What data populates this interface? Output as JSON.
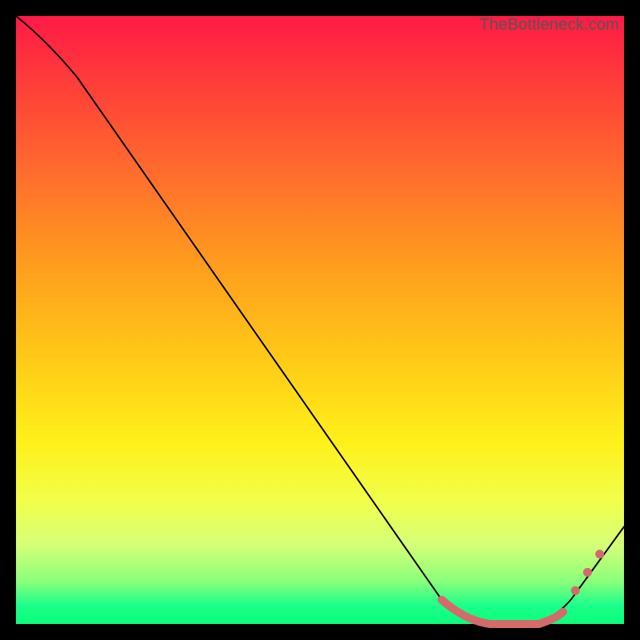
{
  "watermark": "TheBottleneck.com",
  "chart_data": {
    "type": "line",
    "title": "",
    "xlabel": "",
    "ylabel": "",
    "xlim": [
      0,
      100
    ],
    "ylim": [
      0,
      100
    ],
    "grid": false,
    "series": [
      {
        "name": "curve",
        "points": [
          {
            "x": 0,
            "y": 100
          },
          {
            "x": 6,
            "y": 94
          },
          {
            "x": 10,
            "y": 90
          },
          {
            "x": 70,
            "y": 4
          },
          {
            "x": 74,
            "y": 1
          },
          {
            "x": 78,
            "y": 0
          },
          {
            "x": 86,
            "y": 0
          },
          {
            "x": 90,
            "y": 2
          },
          {
            "x": 100,
            "y": 16
          }
        ]
      }
    ],
    "marker_band": {
      "start_x": 70,
      "end_x": 90,
      "dots_x": [
        92,
        94,
        96
      ]
    },
    "colors": {
      "line": "#000000",
      "marker": "#d46a6a",
      "gradient_top": "#ff1a46",
      "gradient_bottom": "#0bff7a"
    }
  }
}
